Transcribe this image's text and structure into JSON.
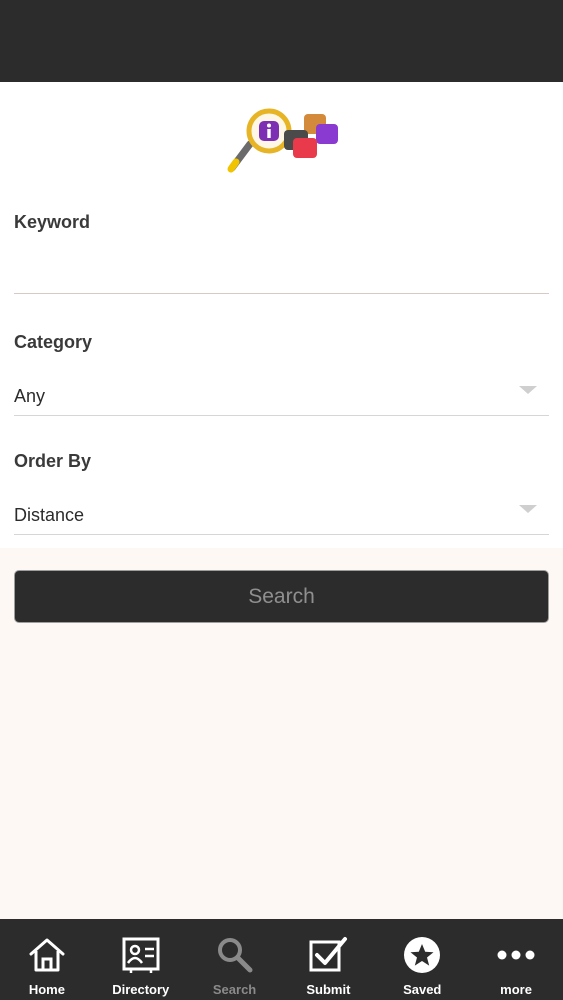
{
  "form": {
    "keyword_label": "Keyword",
    "keyword_value": "",
    "keyword_placeholder": "",
    "category_label": "Category",
    "category_value": "Any",
    "order_label": "Order By",
    "order_value": "Distance"
  },
  "search_button_label": "Search",
  "tabs": [
    {
      "label": "Home",
      "icon": "home-icon",
      "active": false
    },
    {
      "label": "Directory",
      "icon": "directory-card-icon",
      "active": false
    },
    {
      "label": "Search",
      "icon": "search-icon",
      "active": true
    },
    {
      "label": "Submit",
      "icon": "submit-check-icon",
      "active": false
    },
    {
      "label": "Saved",
      "icon": "star-icon",
      "active": false
    },
    {
      "label": "more",
      "icon": "more-dots-icon",
      "active": false
    }
  ],
  "colors": {
    "bar": "#2d2c2c",
    "page_background": "#fdf8f4",
    "form_background": "#ffffff",
    "tab_label": "#ffffff",
    "tab_label_selected": "#8a8a8a"
  }
}
